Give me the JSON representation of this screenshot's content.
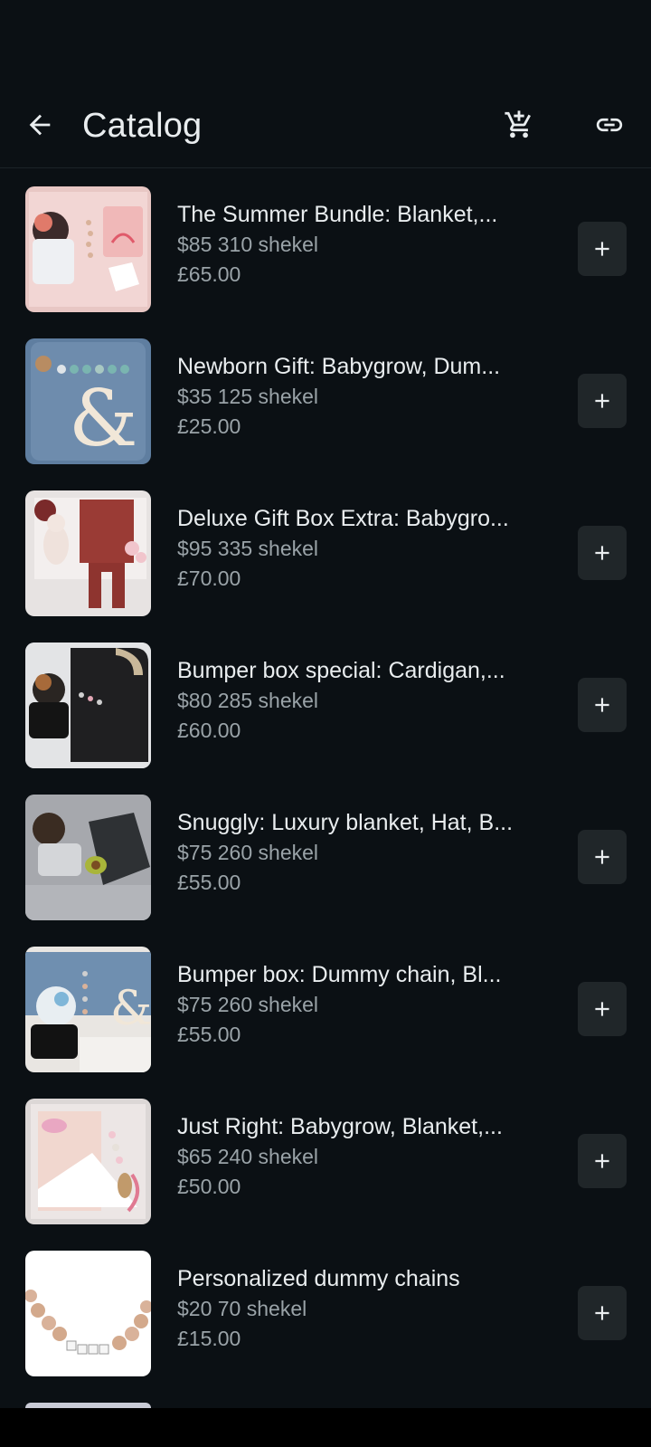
{
  "header": {
    "title": "Catalog",
    "back_icon": "arrow-left-icon",
    "cart_icon": "shopping-cart-icon",
    "link_icon": "link-icon"
  },
  "colors": {
    "background": "#0b1014",
    "text_primary": "#e9edef",
    "text_secondary": "#9aa3a8",
    "button_bg": "#202629"
  },
  "items": [
    {
      "name": "The Summer Bundle: Blanket,...",
      "desc": "$85 310 shekel",
      "price": "£65.00"
    },
    {
      "name": "Newborn Gift: Babygrow, Dum...",
      "desc": "$35 125 shekel",
      "price": "£25.00"
    },
    {
      "name": "Deluxe Gift Box Extra: Babygro...",
      "desc": "$95 335 shekel",
      "price": "£70.00"
    },
    {
      "name": "Bumper box special: Cardigan,...",
      "desc": "$80 285 shekel",
      "price": "£60.00"
    },
    {
      "name": "Snuggly: Luxury blanket, Hat, B...",
      "desc": "$75 260 shekel",
      "price": "£55.00"
    },
    {
      "name": "Bumper box: Dummy chain, Bl...",
      "desc": "$75 260 shekel",
      "price": "£55.00"
    },
    {
      "name": "Just Right: Babygrow, Blanket,...",
      "desc": "$65 240 shekel",
      "price": "£50.00"
    },
    {
      "name": "Personalized dummy chains",
      "desc": "$20 70 shekel",
      "price": "£15.00"
    }
  ],
  "add_icon": "plus-icon"
}
